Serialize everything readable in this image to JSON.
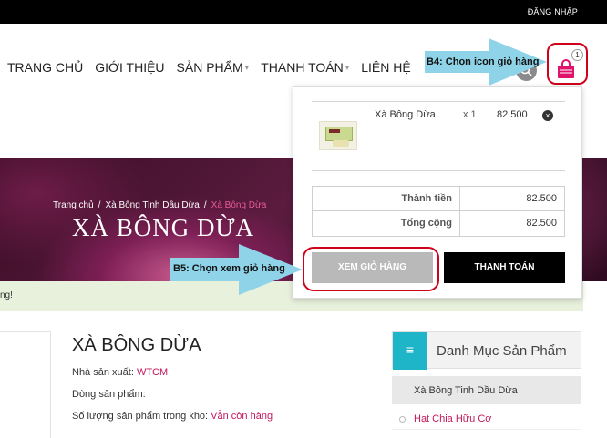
{
  "topbar": {
    "login_label": "ĐĂNG NHẬP"
  },
  "nav": {
    "items": [
      {
        "label": "TRANG CHỦ",
        "has_caret": false
      },
      {
        "label": "GIỚI THIỆU",
        "has_caret": false
      },
      {
        "label": "SẢN PHẨM",
        "has_caret": true
      },
      {
        "label": "THANH TOÁN",
        "has_caret": true
      },
      {
        "label": "LIÊN HỆ",
        "has_caret": false
      }
    ]
  },
  "cart": {
    "count": "1",
    "icon": "shopping-bag-icon",
    "color": "#e0136b"
  },
  "annotations": {
    "step4": "B4: Chọn icon giỏ hàng",
    "step5": "B5: Chọn xem giỏ hàng",
    "arrow_color": "#8fd3e8",
    "outline_color": "#d0021b"
  },
  "banner": {
    "breadcrumb": {
      "home": "Trang chủ",
      "category": "Xà Bông Tinh Dầu Dừa",
      "current": "Xà Bông Dừa"
    },
    "title": "XÀ BÔNG DỪA"
  },
  "notice": {
    "text": "ng!"
  },
  "product": {
    "title": "XÀ BÔNG DỪA",
    "manufacturer_label": "Nhà sản xuất:",
    "manufacturer_value": "WTCM",
    "line_label": "Dòng sản phẩm:",
    "stock_label": "Số lượng sản phẩm trong kho:",
    "stock_value": "Vẫn còn hàng"
  },
  "sidebar": {
    "title": "Danh Mục Sản Phẩm",
    "items": [
      {
        "label": "Xà Bông Tinh Dầu Dừa"
      },
      {
        "label": "Hạt Chia Hữu Cơ"
      }
    ]
  },
  "mini_cart": {
    "item": {
      "name": "Xà Bông Dừa",
      "qty": "x 1",
      "price": "82.500"
    },
    "subtotal_label": "Thành tiền",
    "subtotal_value": "82.500",
    "total_label": "Tổng cộng",
    "total_value": "82.500",
    "view_cart_label": "XEM GIỎ HÀNG",
    "checkout_label": "THANH TOÁN"
  }
}
